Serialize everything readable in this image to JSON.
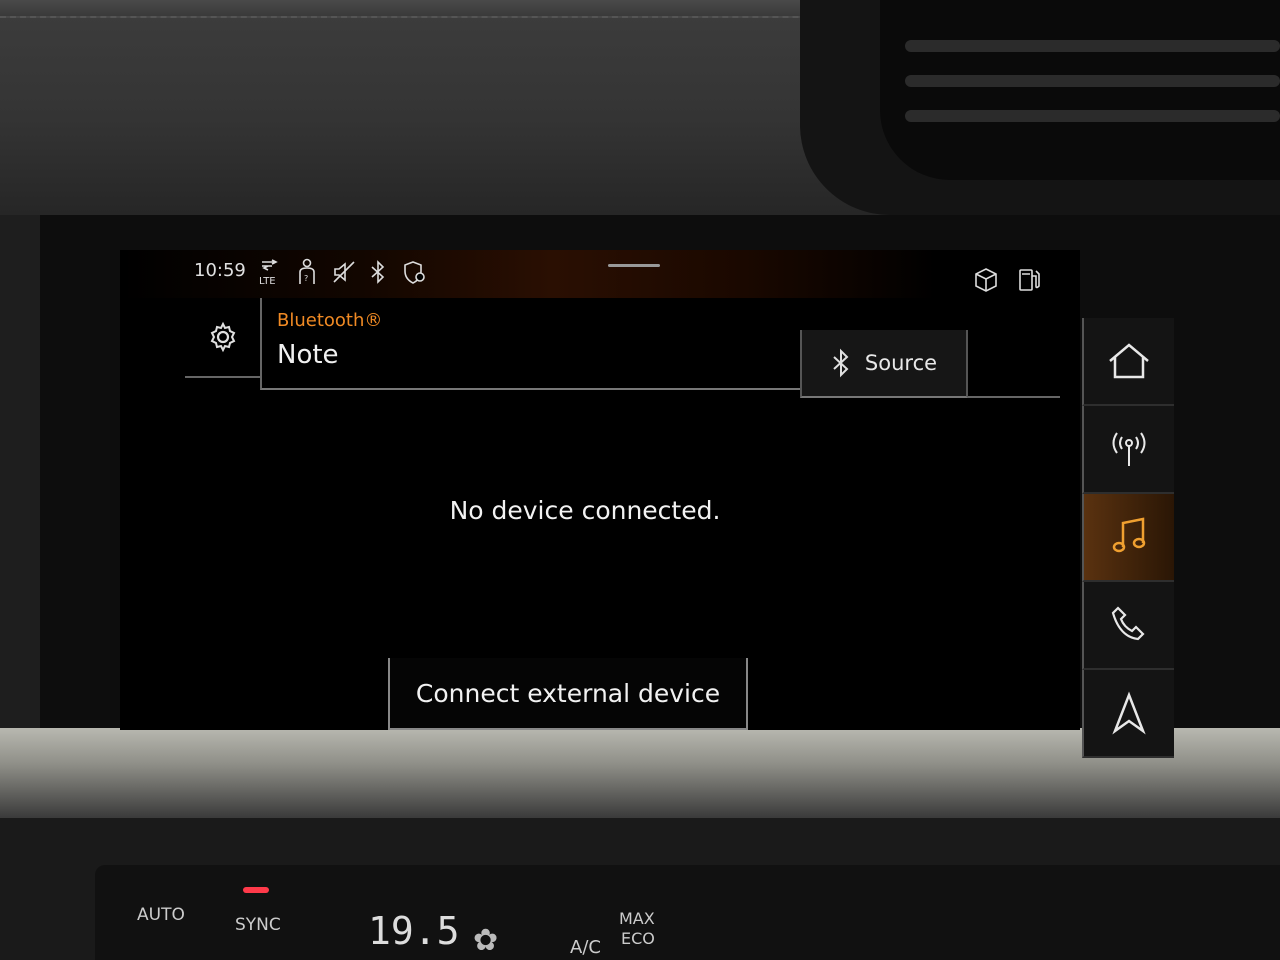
{
  "status": {
    "time": "10:59",
    "icons": [
      "lte-data-icon",
      "passenger-airbag-icon",
      "mute-icon",
      "bluetooth-icon",
      "location-shield-icon",
      "package-icon",
      "fuel-station-icon"
    ]
  },
  "header": {
    "source_type": "Bluetooth®",
    "device_name": "Note",
    "source_button": "Source"
  },
  "main": {
    "message": "No device connected.",
    "connect_button": "Connect external device"
  },
  "sidebar": {
    "items": [
      {
        "name": "home",
        "active": false
      },
      {
        "name": "radio",
        "active": false
      },
      {
        "name": "media",
        "active": true
      },
      {
        "name": "phone",
        "active": false
      },
      {
        "name": "navigation",
        "active": false
      }
    ]
  },
  "climate": {
    "auto_label": "AUTO",
    "sync_label": "SYNC",
    "temperature": "19.5",
    "max_label": "MAX",
    "eco_label": "ECO",
    "ac_label": "A/C"
  },
  "colors": {
    "accent": "#f08a24",
    "screen_bg": "#000000",
    "text": "#f2f2f2"
  }
}
